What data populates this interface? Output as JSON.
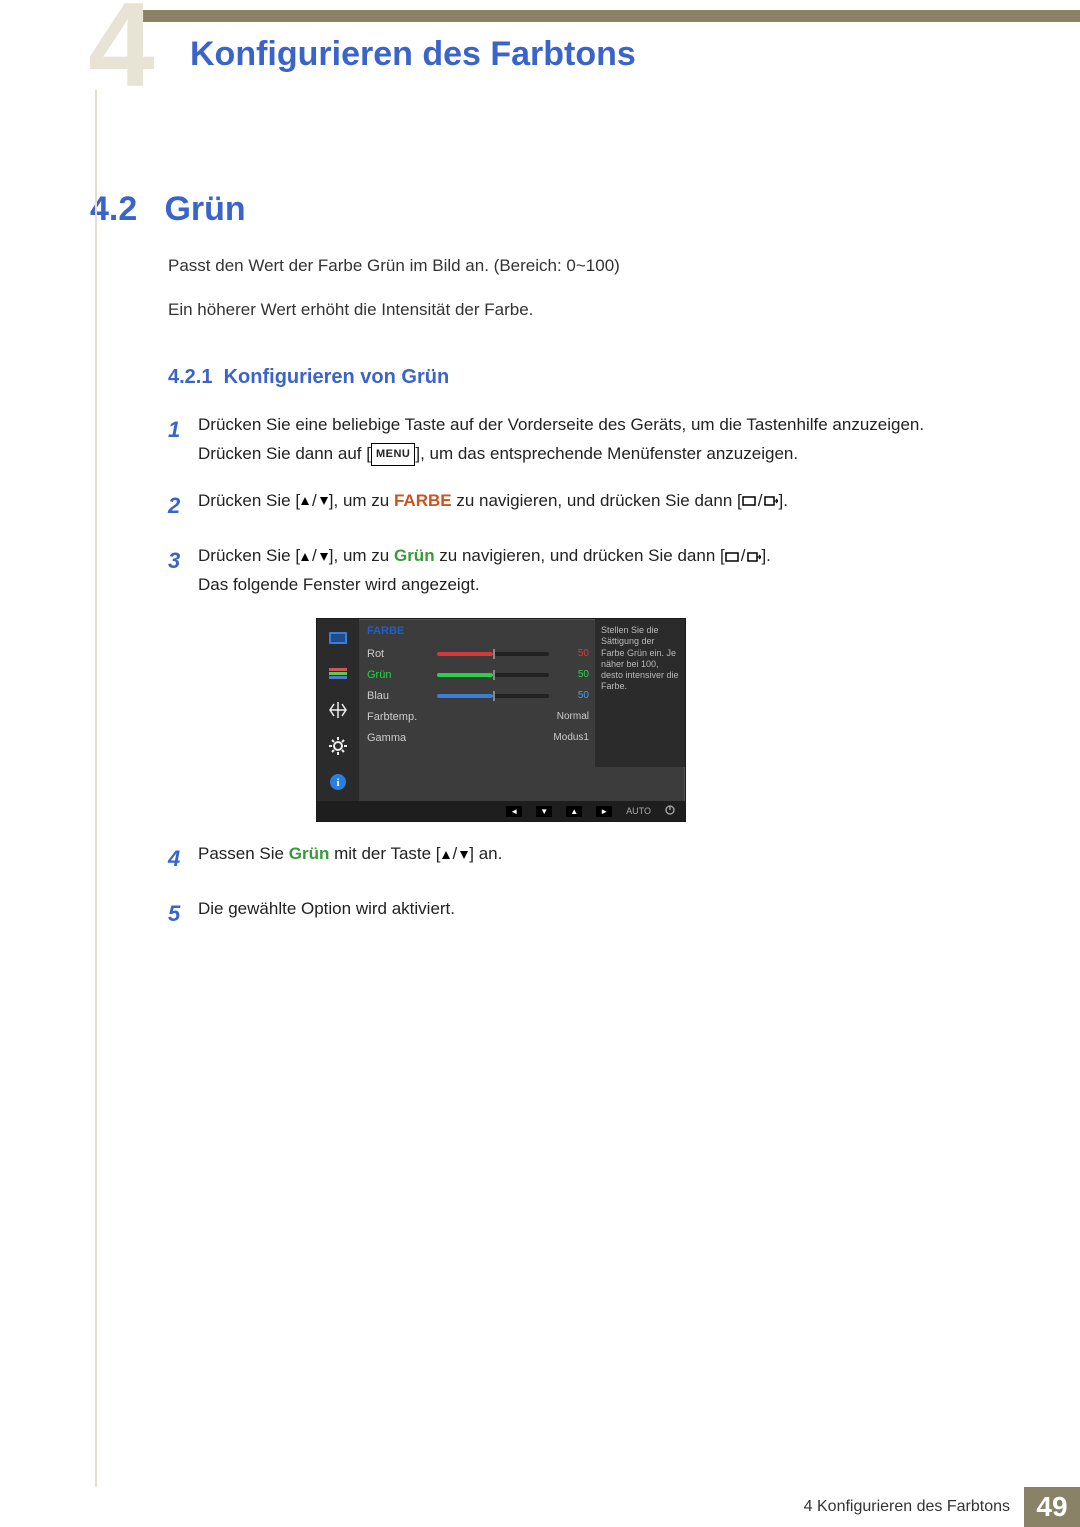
{
  "header": {
    "chapter_tab_number": "4",
    "chapter_title": "Konfigurieren des Farbtons"
  },
  "section": {
    "number": "4.2",
    "title": "Grün"
  },
  "paragraphs": {
    "p1": "Passt den Wert der Farbe Grün im Bild an. (Bereich: 0~100)",
    "p2": "Ein höherer Wert erhöht die Intensität der Farbe."
  },
  "subsection": {
    "number": "4.2.1",
    "title": "Konfigurieren von Grün"
  },
  "buttons": {
    "menu": "MENU",
    "auto": "AUTO"
  },
  "steps": {
    "s1": {
      "n": "1",
      "a": "Drücken Sie eine beliebige Taste auf der Vorderseite des Geräts, um die Tastenhilfe anzuzeigen. Drücken Sie dann auf [",
      "b": "], um das entsprechende Menüfenster anzuzeigen."
    },
    "s2": {
      "n": "2",
      "a": "Drücken Sie [",
      "mid": "], um zu ",
      "target": "FARBE",
      "b": " zu navigieren, und drücken Sie dann [",
      "c": "]."
    },
    "s3": {
      "n": "3",
      "a": "Drücken Sie [",
      "mid": "], um zu ",
      "target": "Grün",
      "b": " zu navigieren, und drücken Sie dann [",
      "c": "].",
      "after": "Das folgende Fenster wird angezeigt."
    },
    "s4": {
      "n": "4",
      "a": "Passen Sie ",
      "target": "Grün",
      "b": " mit der Taste [",
      "c": "] an."
    },
    "s5": {
      "n": "5",
      "text": "Die gewählte Option wird aktiviert."
    }
  },
  "osd": {
    "title": "FARBE",
    "rows": {
      "rot": {
        "label": "Rot",
        "value": "50"
      },
      "gruen": {
        "label": "Grün",
        "value": "50"
      },
      "blau": {
        "label": "Blau",
        "value": "50"
      },
      "farbtemp": {
        "label": "Farbtemp.",
        "value": "Normal"
      },
      "gamma": {
        "label": "Gamma",
        "value": "Modus1"
      }
    },
    "help": "Stellen Sie die Sättigung der Farbe Grün ein. Je näher bei 100, desto intensiver die Farbe."
  },
  "footer": {
    "chapter": "4 Konfigurieren des Farbtons",
    "page": "49"
  }
}
